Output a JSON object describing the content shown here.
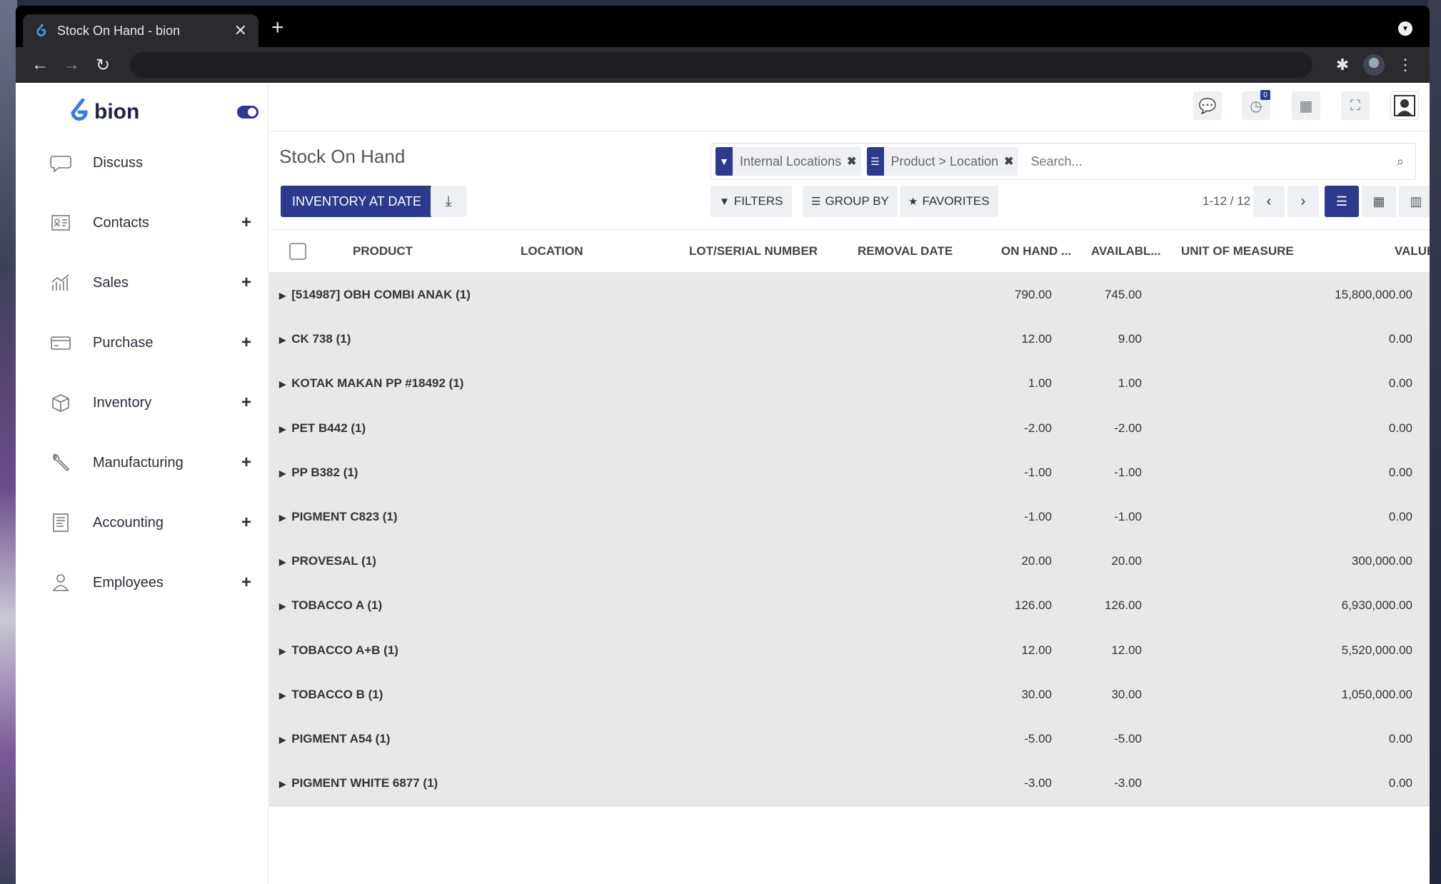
{
  "browser": {
    "tab_title": "Stock On Hand - bion",
    "tab_close": "✕",
    "new_tab": "+"
  },
  "brand": {
    "name": "bion",
    "accent": "#2b3a8c"
  },
  "sidebar": {
    "items": [
      {
        "label": "Discuss",
        "icon": "chat-bubble-icon",
        "has_plus": false
      },
      {
        "label": "Contacts",
        "icon": "contact-card-icon",
        "has_plus": true
      },
      {
        "label": "Sales",
        "icon": "chart-bars-icon",
        "has_plus": true
      },
      {
        "label": "Purchase",
        "icon": "credit-card-icon",
        "has_plus": true
      },
      {
        "label": "Inventory",
        "icon": "box-icon",
        "has_plus": true
      },
      {
        "label": "Manufacturing",
        "icon": "wrench-icon",
        "has_plus": true
      },
      {
        "label": "Accounting",
        "icon": "ledger-icon",
        "has_plus": true
      },
      {
        "label": "Employees",
        "icon": "people-icon",
        "has_plus": true
      }
    ],
    "plus": "+"
  },
  "topbar": {
    "activity_count": "0"
  },
  "control_panel": {
    "title": "Stock On Hand",
    "primary_button": "INVENTORY AT DATE",
    "facets": [
      {
        "label": "Internal Locations",
        "icon": "filter-icon"
      },
      {
        "label": "Product > Location",
        "icon": "group-by-icon"
      }
    ],
    "facet_remove": "✖",
    "search_placeholder": "Search...",
    "filters_label": "FILTERS",
    "groupby_label": "GROUP BY",
    "favorites_label": "FAVORITES",
    "pager": "1-12 / 12"
  },
  "table": {
    "columns": [
      "PRODUCT",
      "LOCATION",
      "LOT/SERIAL NUMBER",
      "REMOVAL DATE",
      "ON HAND ...",
      "AVAILABL...",
      "UNIT OF MEASURE",
      "VALUE"
    ],
    "rows": [
      {
        "group": "[514987] OBH COMBI ANAK (1)",
        "on_hand": "790.00",
        "available": "745.00",
        "value": "15,800,000.00"
      },
      {
        "group": "CK 738 (1)",
        "on_hand": "12.00",
        "available": "9.00",
        "value": "0.00"
      },
      {
        "group": "KOTAK MAKAN PP #18492 (1)",
        "on_hand": "1.00",
        "available": "1.00",
        "value": "0.00"
      },
      {
        "group": "PET B442 (1)",
        "on_hand": "-2.00",
        "available": "-2.00",
        "value": "0.00"
      },
      {
        "group": "PP B382 (1)",
        "on_hand": "-1.00",
        "available": "-1.00",
        "value": "0.00"
      },
      {
        "group": "PIGMENT C823 (1)",
        "on_hand": "-1.00",
        "available": "-1.00",
        "value": "0.00"
      },
      {
        "group": "PROVESAL (1)",
        "on_hand": "20.00",
        "available": "20.00",
        "value": "300,000.00"
      },
      {
        "group": "TOBACCO A (1)",
        "on_hand": "126.00",
        "available": "126.00",
        "value": "6,930,000.00"
      },
      {
        "group": "TOBACCO A+B (1)",
        "on_hand": "12.00",
        "available": "12.00",
        "value": "5,520,000.00"
      },
      {
        "group": "TOBACCO B (1)",
        "on_hand": "30.00",
        "available": "30.00",
        "value": "1,050,000.00"
      },
      {
        "group": "PIGMENT A54 (1)",
        "on_hand": "-5.00",
        "available": "-5.00",
        "value": "0.00"
      },
      {
        "group": "PIGMENT WHITE 6877 (1)",
        "on_hand": "-3.00",
        "available": "-3.00",
        "value": "0.00"
      }
    ]
  }
}
